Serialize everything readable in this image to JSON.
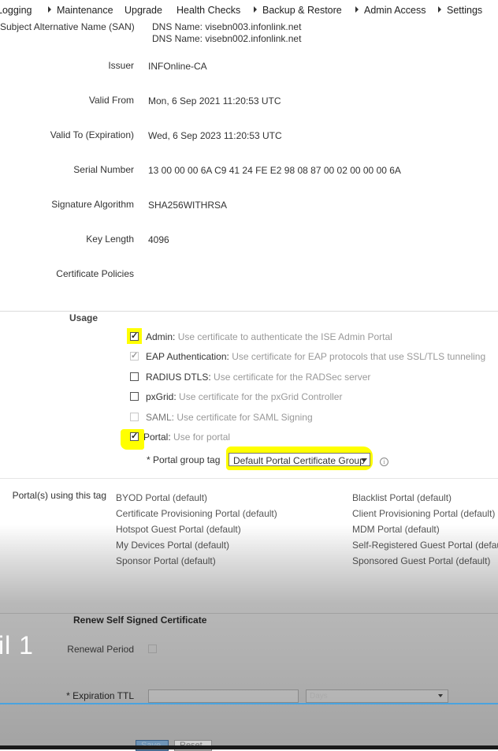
{
  "menu": {
    "items": [
      {
        "label": "Logging",
        "caret": false
      },
      {
        "label": "Maintenance",
        "caret": true
      },
      {
        "label": "Upgrade",
        "caret": false
      },
      {
        "label": "Health Checks",
        "caret": false
      },
      {
        "label": "Backup & Restore",
        "caret": true
      },
      {
        "label": "Admin Access",
        "caret": true
      },
      {
        "label": "Settings",
        "caret": true
      }
    ]
  },
  "certificate": {
    "san_label": "Subject Alternative Name (SAN)",
    "san_values": [
      "DNS Name: visebn003.infonlink.net",
      "DNS Name: visebn002.infonlink.net"
    ],
    "fields": [
      {
        "label": "Issuer",
        "value": "INFOnline-CA"
      },
      {
        "label": "Valid From",
        "value": "Mon, 6 Sep 2021 11:20:53 UTC"
      },
      {
        "label": "Valid To (Expiration)",
        "value": "Wed, 6 Sep 2023 11:20:53 UTC"
      },
      {
        "label": "Serial Number",
        "value": "13 00 00 00 6A C9 41 24 FE E2 98 08 87 00 02 00 00 00 6A"
      },
      {
        "label": "Signature Algorithm",
        "value": "SHA256WITHRSA"
      },
      {
        "label": "Key Length",
        "value": "4096"
      },
      {
        "label": "Certificate Policies",
        "value": ""
      }
    ]
  },
  "usage": {
    "title": "Usage",
    "options": [
      {
        "name": "Admin:",
        "desc": "Use certificate to authenticate the ISE Admin Portal",
        "checked": true,
        "disabled": false
      },
      {
        "name": "EAP Authentication:",
        "desc": "Use certificate for EAP protocols that use SSL/TLS tunneling",
        "checked": true,
        "disabled": true
      },
      {
        "name": "RADIUS DTLS:",
        "desc": "Use certificate for the RADSec server",
        "checked": false,
        "disabled": false
      },
      {
        "name": "pxGrid:",
        "desc": "Use certificate for the pxGrid Controller",
        "checked": false,
        "disabled": false
      },
      {
        "name": "SAML:",
        "desc": "Use certificate for SAML Signing",
        "checked": false,
        "disabled": true
      },
      {
        "name": "Portal:",
        "desc": "Use for portal",
        "checked": true,
        "disabled": false
      }
    ],
    "portal_group_tag_label": "* Portal group tag",
    "portal_group_tag_value": "Default Portal Certificate Group",
    "info_icon": "info-icon"
  },
  "portals": {
    "label": "Portal(s) using this tag",
    "left": [
      "BYOD Portal (default)",
      "Certificate Provisioning Portal (default)",
      "Hotspot Guest Portal (default)",
      "My Devices Portal (default)",
      "Sponsor Portal (default)"
    ],
    "right": [
      "Blacklist Portal (default)",
      "Client Provisioning Portal (default)",
      "MDM Portal (default)",
      "Self-Registered Guest Portal (default)",
      "Sponsored Guest Portal (default)"
    ]
  },
  "renew": {
    "title": "Renew Self Signed Certificate",
    "overlay_text": "il 1",
    "renewal_period_label": "Renewal Period",
    "expiration_ttl_label": "* Expiration TTL",
    "ttl_unit_value": "Days"
  },
  "buttons": {
    "save": "Save",
    "reset": "Reset"
  },
  "colors": {
    "highlight": "#ffff00",
    "accent_blue": "#4aa3df",
    "save_button": "#6f94b6"
  }
}
